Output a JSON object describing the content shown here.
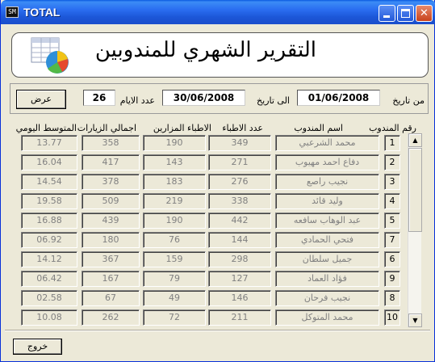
{
  "window": {
    "title": "TOTAL",
    "icon_label": "SM"
  },
  "header": {
    "title": "التقرير الشهري للمندوبين"
  },
  "filter": {
    "from_label": "من تاريخ",
    "from_value": "01/06/2008",
    "to_label": "الى تاريخ",
    "to_value": "30/06/2008",
    "days_label": "عدد الايام",
    "days_value": "26",
    "show_button": "عرض"
  },
  "columns": {
    "num": "رقم المندوب",
    "name": "اسم المندوب",
    "doctors": "عدد الاطباء",
    "visited": "الاطباء المزارين",
    "total": "اجمالي الزيارات",
    "average": "المتوسط اليومي"
  },
  "rows": [
    {
      "num": "1",
      "name": "محمد الشرعبي",
      "doctors": "349",
      "visited": "190",
      "total": "358",
      "average": "13.77"
    },
    {
      "num": "2",
      "name": "دفاع احمد مهيوب",
      "doctors": "271",
      "visited": "143",
      "total": "417",
      "average": "16.04"
    },
    {
      "num": "3",
      "name": "نجيب راصع",
      "doctors": "276",
      "visited": "183",
      "total": "378",
      "average": "14.54"
    },
    {
      "num": "4",
      "name": "وليد قائد",
      "doctors": "338",
      "visited": "219",
      "total": "509",
      "average": "19.58"
    },
    {
      "num": "5",
      "name": "عبد الوهاب سافعه",
      "doctors": "442",
      "visited": "190",
      "total": "439",
      "average": "16.88"
    },
    {
      "num": "7",
      "name": "فتحي الحمادي",
      "doctors": "144",
      "visited": "76",
      "total": "180",
      "average": "06.92"
    },
    {
      "num": "6",
      "name": "جميل سلطان",
      "doctors": "298",
      "visited": "159",
      "total": "367",
      "average": "14.12"
    },
    {
      "num": "9",
      "name": "فؤاد العماد",
      "doctors": "127",
      "visited": "79",
      "total": "167",
      "average": "06.42"
    },
    {
      "num": "8",
      "name": "نجيب فرحان",
      "doctors": "146",
      "visited": "49",
      "total": "67",
      "average": "02.58"
    },
    {
      "num": "10",
      "name": "محمد المتوكل",
      "doctors": "211",
      "visited": "72",
      "total": "262",
      "average": "10.08"
    }
  ],
  "footer": {
    "exit_button": "خروج"
  }
}
